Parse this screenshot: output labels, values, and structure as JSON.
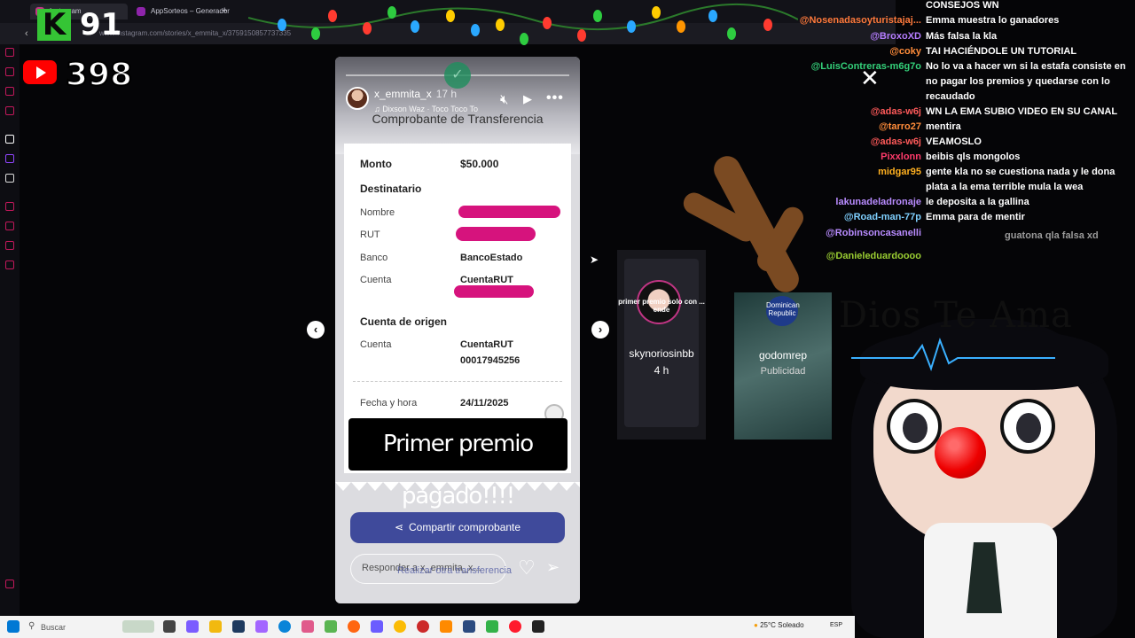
{
  "browser": {
    "tabs": [
      {
        "label": "Instagram"
      },
      {
        "label": "AppSorteos – Generador"
      }
    ],
    "url": "www.instagram.com/stories/x_emmita_x/3759150857737335"
  },
  "overlay": {
    "kick_letter": "K",
    "kick_count": "91",
    "youtube_count": "398"
  },
  "story": {
    "username": "x_emmita_x",
    "time": "17 h",
    "music": "Dixson Waz · Toco Toco To",
    "receipt_title": "Comprobante de Transferencia",
    "monto_label": "Monto",
    "monto_value": "$50.000",
    "destinatario_label": "Destinatario",
    "nombre_label": "Nombre",
    "rut_label": "RUT",
    "banco_label": "Banco",
    "banco_value": "BancoEstado",
    "cuenta_label": "Cuenta",
    "cuenta_value": "CuentaRUT",
    "origen_label": "Cuenta de origen",
    "origen_cuenta_label": "Cuenta",
    "origen_cuenta_value": "CuentaRUT",
    "origen_numero": "00017945256",
    "fecha_label": "Fecha y hora",
    "fecha_value": "24/11/2025",
    "caption": "Primer premio pagado!!!!",
    "share_label": "Compartir comprobante",
    "reply_placeholder": "Responder a x_emmita_x...",
    "reply_ghost": "Realizar otra transferencia"
  },
  "side_cards": [
    {
      "overlay": "primer premio solo con ... ende",
      "username": "skynoriosinbb",
      "time": "4 h"
    },
    {
      "logo": "Dominican Republic",
      "username": "godomrep",
      "sub": "Publicidad"
    }
  ],
  "art_text": "Dios Te Ama",
  "chat": [
    {
      "user": "",
      "msg": "CONSEJOS WN",
      "color": "#ffffff"
    },
    {
      "user": "@Nosenadasoyturistajaj...",
      "msg": "Emma muestra lo ganadores",
      "color": "#ff7a3c"
    },
    {
      "user": "@BroxoXD",
      "msg": "Más falsa la kla",
      "color": "#b57dff"
    },
    {
      "user": "@coky",
      "msg": "TAI HACIÉNDOLE UN TUTORIAL",
      "color": "#ff8c3a"
    },
    {
      "user": "@LuisContreras-m6g7o",
      "msg": "No lo va a hacer wn si la estafa consiste en no pagar los premios y quedarse con lo recaudado",
      "color": "#34d17a"
    },
    {
      "user": "@adas-w6j",
      "msg": "WN LA EMA SUBIO VIDEO EN SU CANAL",
      "color": "#ff5a5a"
    },
    {
      "user": "@tarro27",
      "msg": "mentira",
      "color": "#ff8c3a"
    },
    {
      "user": "@adas-w6j",
      "msg": "VEAMOSLO",
      "color": "#ff5a5a"
    },
    {
      "user": "Pixxlonn",
      "msg": "beibis qls mongolos",
      "color": "#ff3b6b"
    },
    {
      "user": "midgar95",
      "msg": "gente kla no se cuestiona nada y le dona plata a la ema terrible mula la wea",
      "color": "#ffb020"
    },
    {
      "user": "lakunadeladronaje",
      "msg": "le deposita a la gallina",
      "color": "#b98cff"
    },
    {
      "user": "@Road-man-77p",
      "msg": "Emma para de mentir",
      "color": "#7fd0ff"
    },
    {
      "user": "@Robinsoncasanelli",
      "msg": "guatona qla falsa xd",
      "color": "#b98cff"
    },
    {
      "user": "@Danieleduardoooo",
      "msg": "",
      "color": "#9acd32"
    }
  ],
  "taskbar": {
    "search": "Buscar",
    "weather": "25°C Soleado",
    "lang": "ESP"
  }
}
